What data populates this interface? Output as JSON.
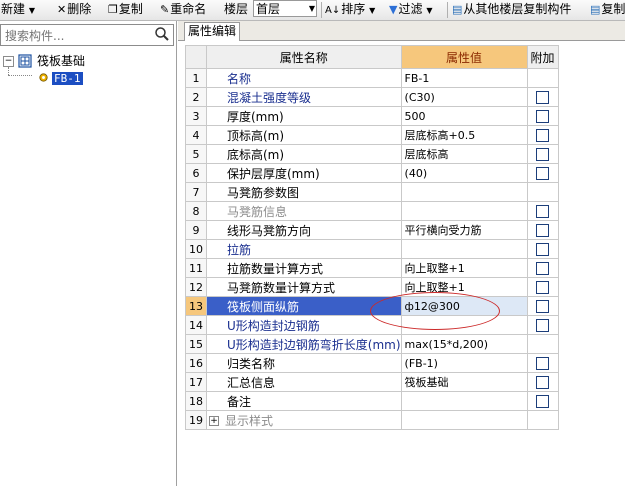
{
  "toolbar": {
    "new_label": "新建",
    "delete_label": "删除",
    "copy_label": "复制",
    "rename_label": "重命名",
    "floor_label": "楼层",
    "floor_value": "首层",
    "sort_label": "排序",
    "filter_label": "过滤",
    "copy_from_floor_label": "从其他楼层复制构件",
    "copy_to_label": "复制"
  },
  "left": {
    "search_placeholder": "搜索构件...",
    "tree_root": "筏板基础",
    "tree_leaf": "FB-1"
  },
  "tabs": {
    "active": "属性编辑"
  },
  "grid": {
    "headers": {
      "name": "属性名称",
      "value": "属性值",
      "extra": "附加"
    },
    "rows": [
      {
        "num": "1",
        "name": "名称",
        "value": "FB-1",
        "color": "blue",
        "check": false
      },
      {
        "num": "2",
        "name": "混凝土强度等级",
        "value": "(C30)",
        "color": "blue",
        "check": true
      },
      {
        "num": "3",
        "name": "厚度(mm)",
        "value": "500",
        "color": "black",
        "check": true
      },
      {
        "num": "4",
        "name": "顶标高(m)",
        "value": "层底标高+0.5",
        "color": "black",
        "check": true
      },
      {
        "num": "5",
        "name": "底标高(m)",
        "value": "层底标高",
        "color": "black",
        "check": true
      },
      {
        "num": "6",
        "name": "保护层厚度(mm)",
        "value": "(40)",
        "color": "black",
        "check": true
      },
      {
        "num": "7",
        "name": "马凳筋参数图",
        "value": "",
        "color": "black",
        "check": false
      },
      {
        "num": "8",
        "name": "马凳筋信息",
        "value": "",
        "color": "gray",
        "check": true
      },
      {
        "num": "9",
        "name": "线形马凳筋方向",
        "value": "平行横向受力筋",
        "color": "black",
        "check": true
      },
      {
        "num": "10",
        "name": "拉筋",
        "value": "",
        "color": "blue",
        "check": true
      },
      {
        "num": "11",
        "name": "拉筋数量计算方式",
        "value": "向上取整+1",
        "color": "black",
        "check": true
      },
      {
        "num": "12",
        "name": "马凳筋数量计算方式",
        "value": "向上取整+1",
        "color": "black",
        "check": true
      },
      {
        "num": "13",
        "name": "筏板侧面纵筋",
        "value": "ф12@300",
        "color": "selected",
        "check": true
      },
      {
        "num": "14",
        "name": "U形构造封边钢筋",
        "value": "",
        "color": "blue",
        "check": true
      },
      {
        "num": "15",
        "name": "U形构造封边钢筋弯折长度(mm)",
        "value": "max(15*d,200)",
        "color": "blue",
        "check": false
      },
      {
        "num": "16",
        "name": "归类名称",
        "value": "(FB-1)",
        "color": "black",
        "check": true
      },
      {
        "num": "17",
        "name": "汇总信息",
        "value": "筏板基础",
        "color": "black",
        "check": true
      },
      {
        "num": "18",
        "name": "备注",
        "value": "",
        "color": "black",
        "check": true
      },
      {
        "num": "19",
        "name": "显示样式",
        "value": "",
        "color": "gray",
        "check": false,
        "expander": "+"
      }
    ]
  },
  "colors": {
    "selection": "#3a5fc8",
    "header_value_bg": "#f6c77c",
    "annotation": "#cc2a2a"
  }
}
